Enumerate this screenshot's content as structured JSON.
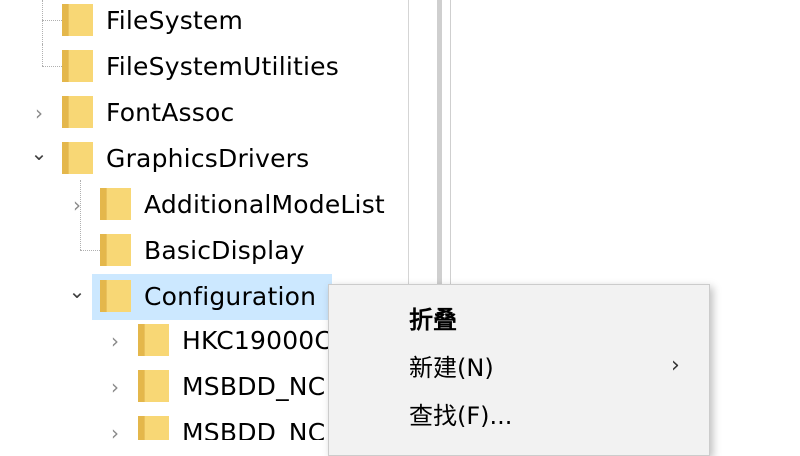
{
  "tree": {
    "items": [
      {
        "label": "FileSystem"
      },
      {
        "label": "FileSystemUtilities"
      },
      {
        "label": "FontAssoc"
      },
      {
        "label": "GraphicsDrivers"
      },
      {
        "label": "AdditionalModeList"
      },
      {
        "label": "BasicDisplay"
      },
      {
        "label": "Configuration"
      },
      {
        "label": "HKC19000C"
      },
      {
        "label": "MSBDD_NC"
      },
      {
        "label": "MSBDD_NC"
      }
    ]
  },
  "context_menu": {
    "items": [
      {
        "label": "折叠"
      },
      {
        "label": "新建(N)",
        "submenu_glyph": "›"
      },
      {
        "label": "查找(F)..."
      }
    ]
  },
  "glyphs": {
    "collapsed": "›",
    "expanded": "⌄"
  },
  "colors": {
    "selection": "#cce8ff",
    "folder": "#f8d775",
    "menu_bg": "#f2f2f2"
  }
}
